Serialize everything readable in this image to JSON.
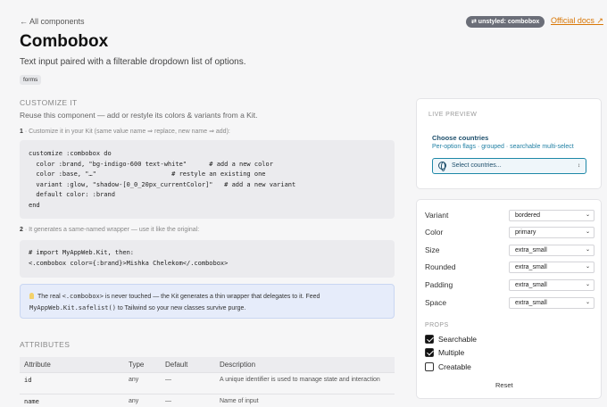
{
  "header": {
    "back_label": "← All components",
    "badge": "⇄ unstyled: combobox",
    "docs_label": "Official docs ↗"
  },
  "page": {
    "title": "Combobox",
    "subtitle": "Text input paired with a filterable dropdown list of options.",
    "tag": "forms"
  },
  "customize": {
    "heading": "CUSTOMIZE IT",
    "description": "Reuse this component — add or restyle its colors & variants from a Kit.",
    "step1_num": "1",
    "step1_text": " · Customize it in your Kit (same value name ⇒ replace, new name ⇒ add):",
    "code1": "customize :combobox do\n  color :brand, \"bg-indigo-600 text-white\"      # add a new color\n  color :base, \"…\"                    # restyle an existing one\n  variant :glow, \"shadow-[0_0_20px_currentColor]\"   # add a new variant\n  default color: :brand\nend",
    "step2_num": "2",
    "step2_text": " · It generates a same-named wrapper — use it like the original:",
    "code2": "# import MyAppWeb.Kit, then:\n<.combobox color={:brand}>Mishka Chelekom</.combobox>",
    "note_a": "The real ",
    "note_code_a": "<.combobox>",
    "note_b": " is never touched — the Kit generates a thin wrapper that delegates to it. Feed",
    "note_code_b": "MyAppWeb.Kit.safelist()",
    "note_c": " to Tailwind so your new classes survive purge."
  },
  "attributes": {
    "heading": "ATTRIBUTES",
    "columns": [
      "Attribute",
      "Type",
      "Default",
      "Description"
    ],
    "rows": [
      {
        "name": "id",
        "type": "any",
        "default": "—",
        "description": "A unique identifier is used to manage state and interaction"
      },
      {
        "name": "name",
        "type": "any",
        "default": "—",
        "description": "Name of input"
      }
    ]
  },
  "preview": {
    "heading": "LIVE PREVIEW",
    "title": "Choose countries",
    "description": "Per-option flags · grouped · searchable multi-select",
    "placeholder": "Select countries..."
  },
  "controls": {
    "fields": [
      {
        "label": "Variant",
        "value": "bordered"
      },
      {
        "label": "Color",
        "value": "primary"
      },
      {
        "label": "Size",
        "value": "extra_small"
      },
      {
        "label": "Rounded",
        "value": "extra_small"
      },
      {
        "label": "Padding",
        "value": "extra_small"
      },
      {
        "label": "Space",
        "value": "extra_small"
      }
    ],
    "props_heading": "PROPS",
    "props": [
      {
        "label": "Searchable",
        "checked": true
      },
      {
        "label": "Multiple",
        "checked": true
      },
      {
        "label": "Creatable",
        "checked": false
      }
    ],
    "reset_label": "Reset"
  },
  "colors": {
    "accent": "#1e88a8",
    "docs_link": "#d97706",
    "badge_bg": "#6b6e78"
  }
}
